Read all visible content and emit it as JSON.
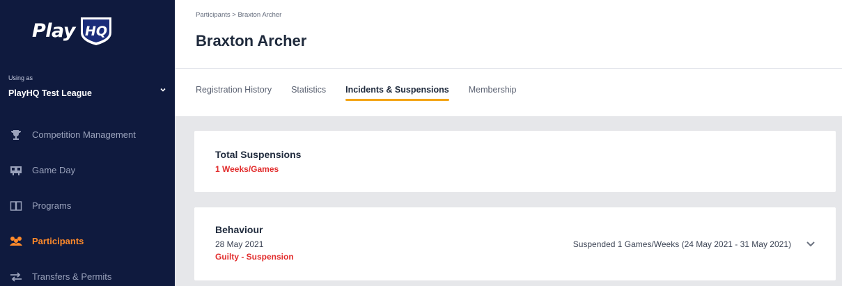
{
  "brand": {
    "logo_text": "Play",
    "logo_badge": "HQ"
  },
  "org": {
    "using_as_label": "Using as",
    "name": "PlayHQ Test League"
  },
  "sidebar": {
    "items": [
      {
        "label": "Competition Management",
        "icon": "trophy-icon",
        "active": false
      },
      {
        "label": "Game Day",
        "icon": "scoreboard-icon",
        "active": false
      },
      {
        "label": "Programs",
        "icon": "book-icon",
        "active": false
      },
      {
        "label": "Participants",
        "icon": "people-icon",
        "active": true
      },
      {
        "label": "Transfers & Permits",
        "icon": "transfer-arrows-icon",
        "active": false
      }
    ]
  },
  "header": {
    "breadcrumb": "Participants > Braxton Archer",
    "title": "Braxton Archer"
  },
  "tabs": [
    {
      "label": "Registration History",
      "active": false
    },
    {
      "label": "Statistics",
      "active": false
    },
    {
      "label": "Incidents & Suspensions",
      "active": true
    },
    {
      "label": "Membership",
      "active": false
    }
  ],
  "summary": {
    "title": "Total Suspensions",
    "value": "1 Weeks/Games"
  },
  "incident": {
    "type": "Behaviour",
    "date": "28 May 2021",
    "outcome": "Guilty - Suspension",
    "detail": "Suspended 1 Games/Weeks (24 May 2021 - 31 May 2021)"
  },
  "colors": {
    "sidebar_bg": "#0f1a3e",
    "accent_orange": "#ff8a2a",
    "tab_underline": "#f3a414",
    "alert_red": "#e22d2d"
  }
}
